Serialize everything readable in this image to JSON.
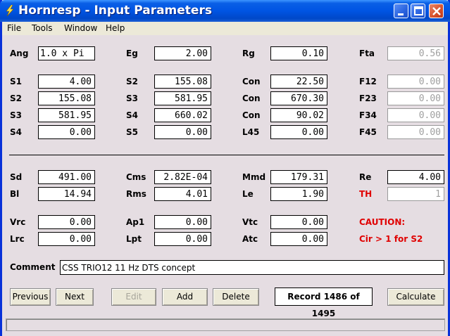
{
  "window": {
    "title": "Hornresp - Input Parameters"
  },
  "menu": [
    "File",
    "Tools",
    "Window",
    "Help"
  ],
  "row_ang": {
    "ang": "1.0 x Pi",
    "eg": "2.00",
    "rg": "0.10",
    "fta": "0.56"
  },
  "labels": {
    "ang": "Ang",
    "eg": "Eg",
    "rg": "Rg",
    "fta": "Fta",
    "s1": "S1",
    "s2": "S2",
    "s3": "S3",
    "s4": "S4",
    "s5": "S5",
    "con": "Con",
    "l45": "L45",
    "f12": "F12",
    "f23": "F23",
    "f34": "F34",
    "f45": "F45",
    "sd": "Sd",
    "bl": "Bl",
    "cms": "Cms",
    "rms": "Rms",
    "mmd": "Mmd",
    "le": "Le",
    "re": "Re",
    "th": "TH",
    "vrc": "Vrc",
    "lrc": "Lrc",
    "ap1": "Ap1",
    "lpt": "Lpt",
    "vtc": "Vtc",
    "atc": "Atc",
    "comment": "Comment"
  },
  "horn": {
    "s1": "4.00",
    "s2_left": "155.08",
    "s3_left": "581.95",
    "s4_left": "0.00",
    "s2": "155.08",
    "s3": "581.95",
    "s4": "660.02",
    "s5": "0.00",
    "con1": "22.50",
    "con2": "670.30",
    "con3": "90.02",
    "l45": "0.00",
    "f12": "0.00",
    "f23": "0.00",
    "f34": "0.00",
    "f45": "0.00"
  },
  "driver": {
    "sd": "491.00",
    "bl": "14.94",
    "cms": "2.82E-04",
    "rms": "4.01",
    "mmd": "179.31",
    "le": "1.90",
    "re": "4.00",
    "th": "1"
  },
  "chambers": {
    "vrc": "0.00",
    "lrc": "0.00",
    "ap1": "0.00",
    "lpt": "0.00",
    "vtc": "0.00",
    "atc": "0.00"
  },
  "caution": {
    "title": "CAUTION:",
    "message": "Cir > 1 for S2"
  },
  "comment": "CSS TRIO12 11 Hz DTS concept",
  "buttons": {
    "previous": "Previous",
    "next": "Next",
    "edit": "Edit",
    "add": "Add",
    "delete": "Delete",
    "calculate": "Calculate"
  },
  "record": "Record 1486 of 1495",
  "colors": {
    "title_bar": "#0054e3",
    "client_bg": "#e5dde2",
    "caution": "#e00000"
  }
}
